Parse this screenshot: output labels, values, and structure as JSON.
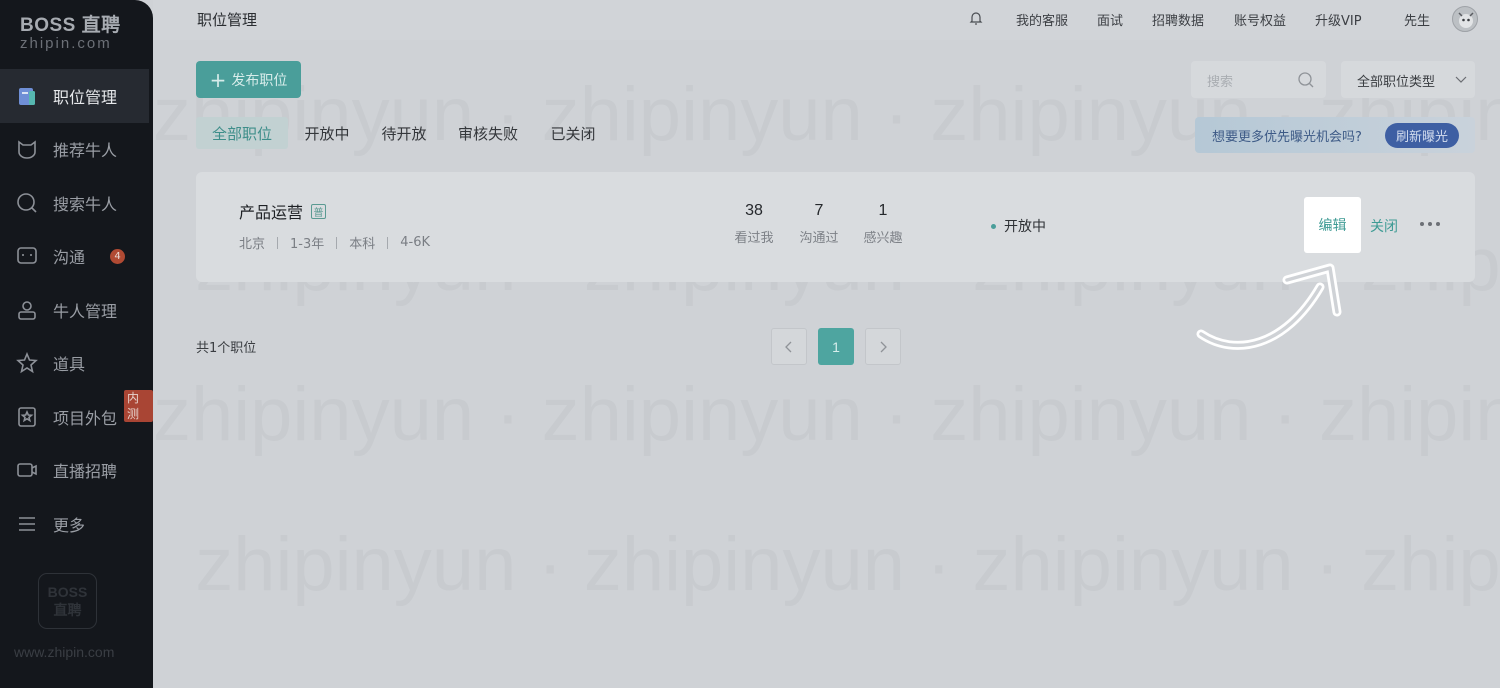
{
  "brand": {
    "main": "BOSS 直聘",
    "sub": "zhipin.com"
  },
  "sidebar": {
    "items": [
      {
        "label": "职位管理",
        "icon": "briefcase-icon",
        "active": true
      },
      {
        "label": "推荐牛人",
        "icon": "cat-face-icon"
      },
      {
        "label": "搜索牛人",
        "icon": "search-icon"
      },
      {
        "label": "沟通",
        "icon": "chat-icon",
        "badge": "4"
      },
      {
        "label": "牛人管理",
        "icon": "user-icon"
      },
      {
        "label": "道具",
        "icon": "star-icon"
      },
      {
        "label": "项目外包",
        "icon": "star-badge-icon",
        "tag": "内测"
      },
      {
        "label": "直播招聘",
        "icon": "video-camera-icon"
      },
      {
        "label": "更多",
        "icon": "menu-icon"
      }
    ],
    "footer_logo": {
      "line1": "BOSS",
      "line2": "直聘"
    },
    "footer_url": "www.zhipin.com"
  },
  "topbar": {
    "title": "职位管理",
    "links": [
      "我的客服",
      "面试",
      "招聘数据",
      "账号权益",
      "升级VIP",
      "先生"
    ]
  },
  "toolbar": {
    "publish_label": "发布职位",
    "search_placeholder": "搜索",
    "type_select_value": "全部职位类型"
  },
  "tabs": [
    "全部职位",
    "开放中",
    "待开放",
    "审核失败",
    "已关闭"
  ],
  "promo": {
    "text": "想要更多优先曝光机会吗?",
    "button": "刷新曝光"
  },
  "job": {
    "title": "产品运营",
    "tag": "普",
    "meta": [
      "北京",
      "1-3年",
      "本科",
      "4-6K"
    ],
    "stats": [
      {
        "num": "38",
        "label": "看过我"
      },
      {
        "num": "7",
        "label": "沟通过"
      },
      {
        "num": "1",
        "label": "感兴趣"
      }
    ],
    "status": "开放中",
    "edit_label": "编辑",
    "close_label": "关闭"
  },
  "pagination": {
    "total_text": "共1个职位",
    "current": "1"
  },
  "colors": {
    "accent": "#4a9e9a",
    "sidebar_bg": "#14171c",
    "badge_red": "#b04a33"
  }
}
